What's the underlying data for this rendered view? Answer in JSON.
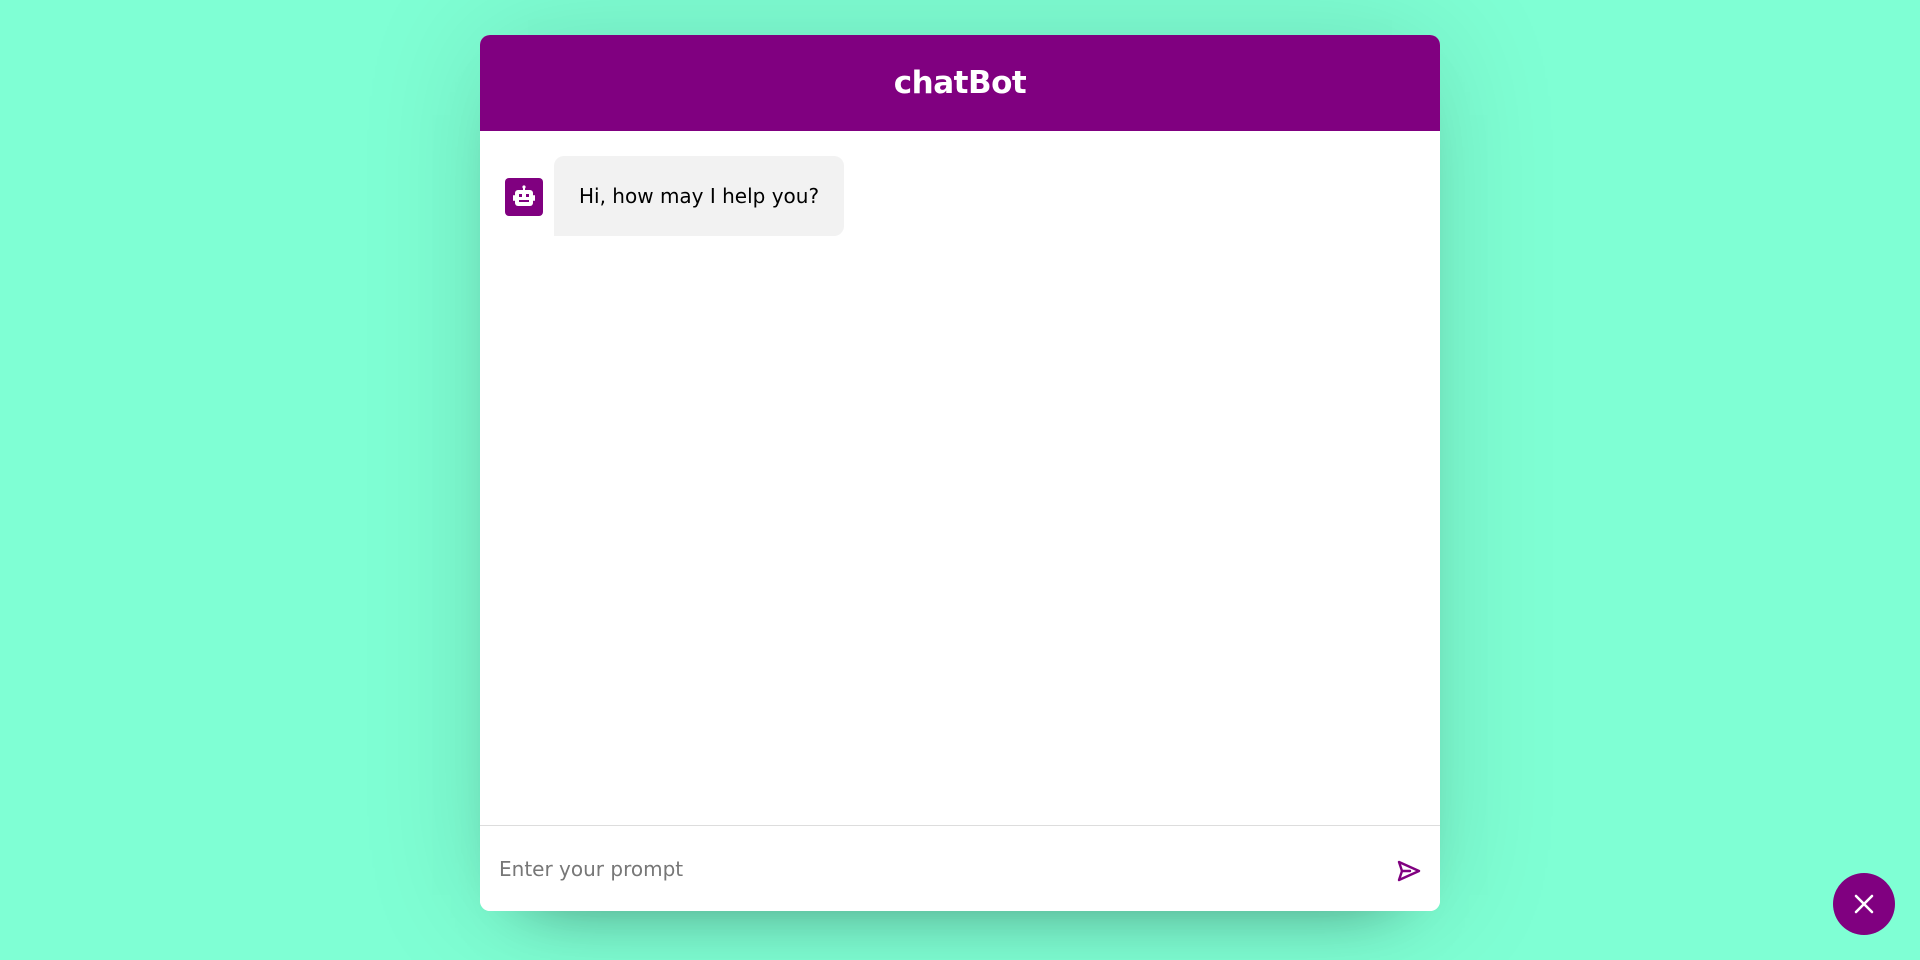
{
  "chatbot": {
    "title": "chatBot",
    "messages": [
      {
        "sender": "bot",
        "text": "Hi, how may I help you?"
      }
    ],
    "input": {
      "placeholder": "Enter your prompt",
      "value": ""
    }
  },
  "icons": {
    "avatar": "robot-icon",
    "send": "send-icon",
    "toggle": "close-icon"
  },
  "colors": {
    "background": "#7fffd4",
    "accent": "#800080",
    "bubble": "#f2f2f2"
  }
}
